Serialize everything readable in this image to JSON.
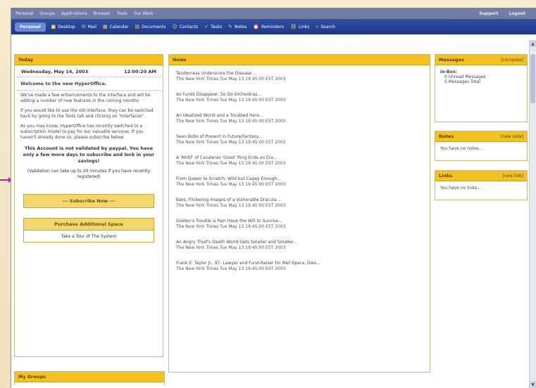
{
  "menubar": {
    "items": [
      "Personal",
      "Groups",
      "Applications",
      "Browser",
      "Tools",
      "Our Work"
    ],
    "right": [
      "Support",
      "Logout"
    ]
  },
  "toolbar": {
    "brand": "Personal",
    "items": [
      {
        "label": "Desktop",
        "icon": "desktop-icon",
        "glyph": "■"
      },
      {
        "label": "Mail",
        "icon": "mail-icon",
        "glyph": "✉"
      },
      {
        "label": "Calendar",
        "icon": "calendar-icon",
        "glyph": "▦"
      },
      {
        "label": "Documents",
        "icon": "documents-icon",
        "glyph": "▤"
      },
      {
        "label": "Contacts",
        "icon": "contacts-icon",
        "glyph": "☺"
      },
      {
        "label": "Tasks",
        "icon": "tasks-icon",
        "glyph": "✓"
      },
      {
        "label": "Notes",
        "icon": "notes-icon",
        "glyph": "✎"
      },
      {
        "label": "Reminders",
        "icon": "reminders-icon",
        "glyph": "⏰"
      },
      {
        "label": "Links",
        "icon": "links-icon",
        "glyph": "⛓"
      },
      {
        "label": "Search",
        "icon": "search-icon",
        "glyph": "⌕"
      }
    ]
  },
  "today": {
    "title": "Today",
    "date": "Wednesday, May 14, 2003",
    "time": "12:00:20 AM",
    "welcome": "Welcome to the new HyperOffice.",
    "p1": "We've made a few enhancements to the interface and will be adding a number of new features in the coming months.",
    "p2": "If you would like to use the old interface, they can be switched back by going to the Tools tab and clicking on \"Interfaces\".",
    "p3": "As you may know, HyperOffice has recently switched to a subscription model to pay for our valuable services. If you haven't already done so, please subscribe below.",
    "warning": "This Account is not validated by paypal. You have only a few more days to subscribe and lock in your savings!",
    "note": "(Validation can take up to 20 minutes if you have recently registered)",
    "subscribe": "--- Subscribe Now ---",
    "purchase": "Purchase Additional Space",
    "tour": "Take a Tour of The System"
  },
  "news": {
    "title": "News",
    "items": [
      {
        "headline": "Tenderness Underscore the Disease...",
        "source": "The New York Times  Tue May 13 19:45:00 EST 2003"
      },
      {
        "headline": "As Funds Disappear, So Do Orchestras...",
        "source": "The New York Times  Tue May 13 19:45:00 EST 2003"
      },
      {
        "headline": "An Idealized World and a Troubled Hero...",
        "source": "The New York Times  Tue May 13 19:45:00 EST 2003"
      },
      {
        "headline": "Seen Bobs of Present in Future/Fantasy...",
        "source": "The New York Times  Tue May 13 19:45:00 EST 2003"
      },
      {
        "headline": "A 'Motif' of Cavaleras 'Grest' Ring Ends an Era...",
        "source": "The New York Times  Tue May 13 19:45:00 EST 2003"
      },
      {
        "headline": "From Queen to Scratch: Wild but Cagey Enough...",
        "source": "The New York Times  Tue May 13 19:45:00 EST 2003"
      },
      {
        "headline": "Bare, Flickering Images of a Vulnerable Dracula...",
        "source": "The New York Times  Tue May 13 19:45:00 EST 2003"
      },
      {
        "headline": "Golden's Trouble is Pain Have the Will to Survive...",
        "source": "The New York Times  Tue May 13 19:45:00 EST 2003"
      },
      {
        "headline": "An Angry Thief's Death World Gets Smaller and Smaller...",
        "source": "The New York Times  Tue May 13 19:45:00 EST 2003"
      },
      {
        "headline": "Frank E. Taylor Jr., 87, Lawyer and Fund-Raiser for Met Opera, Dies...",
        "source": "The New York Times  Tue May 13 19:45:00 EST 2003"
      }
    ]
  },
  "messages": {
    "title": "Messages",
    "link": "[compose]",
    "inbox": "In-Box:",
    "unread": "0 Unread Messages",
    "total": "0 Messages Total"
  },
  "notes": {
    "title": "Notes",
    "link": "[new note]",
    "empty": "You have no notes..."
  },
  "links": {
    "title": "Links",
    "link": "[new link]",
    "empty": "You have no links..."
  },
  "groups": {
    "title": "My Groups"
  }
}
